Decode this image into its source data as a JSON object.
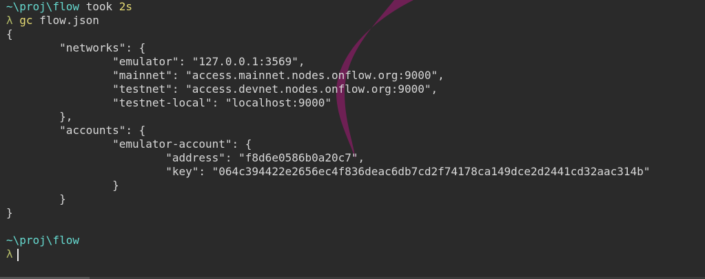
{
  "session1": {
    "cwd": "~\\proj\\flow",
    "took_label": " took ",
    "took_time": "2s",
    "prompt_symbol": "λ",
    "command": "gc",
    "argument": " flow.json"
  },
  "output_lines": [
    "{",
    "        \"networks\": {",
    "                \"emulator\": \"127.0.0.1:3569\",",
    "                \"mainnet\": \"access.mainnet.nodes.onflow.org:9000\",",
    "                \"testnet\": \"access.devnet.nodes.onflow.org:9000\",",
    "                \"testnet-local\": \"localhost:9000\"",
    "        },",
    "        \"accounts\": {",
    "                \"emulator-account\": {",
    "                        \"address\": \"f8d6e0586b0a20c7\",",
    "                        \"key\": \"064c394422e2656ec4f836deac6db7cd2f74178ca149dce2d2441cd32aac314b\"",
    "                }",
    "        }",
    "}"
  ],
  "session2": {
    "cwd": "~\\proj\\flow",
    "prompt_symbol": "λ"
  },
  "colors": {
    "background": "#2a2a2a",
    "cwd": "#66d9cf",
    "command": "#e6db74",
    "prompt": "#b5bd68",
    "text": "#d8d8d8",
    "watermark": "#7a1f5c"
  }
}
